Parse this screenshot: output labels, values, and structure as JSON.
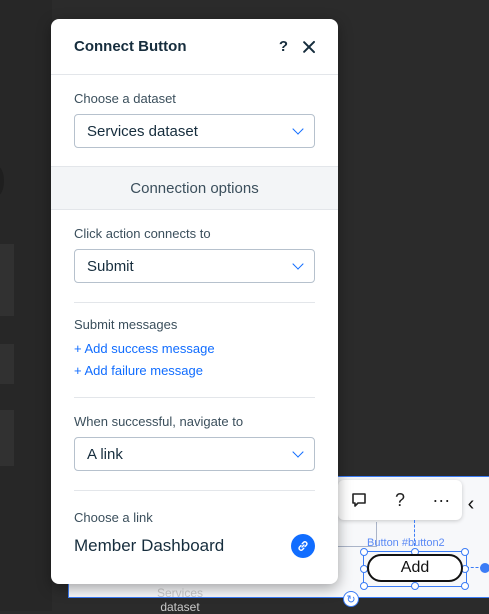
{
  "panel": {
    "title": "Connect Button",
    "help_glyph": "?",
    "dataset_label": "Choose a dataset",
    "dataset_value": "Services dataset",
    "connection_options": "Connection options",
    "click_action_label": "Click action connects to",
    "click_action_value": "Submit",
    "submit_messages_label": "Submit messages",
    "add_success": "+ Add success message",
    "add_failure": "+ Add failure message",
    "navigate_label": "When successful, navigate to",
    "navigate_value": "A link",
    "choose_link_label": "Choose a link",
    "link_value": "Member Dashboard"
  },
  "canvas": {
    "element_label": "Button #button2",
    "button_label": "Add",
    "ghost_label": "Services dataset",
    "toolbar_help": "?",
    "toolbar_more": "···"
  },
  "icons": {
    "help": "help-icon",
    "close": "close-icon",
    "chevron": "chevron-down-icon",
    "link": "link-icon",
    "comment": "comment-icon",
    "more": "more-icon",
    "rotate": "rotate-icon"
  },
  "colors": {
    "accent": "#116dff",
    "title": "#162d3d",
    "selection": "#3b7cf6"
  }
}
